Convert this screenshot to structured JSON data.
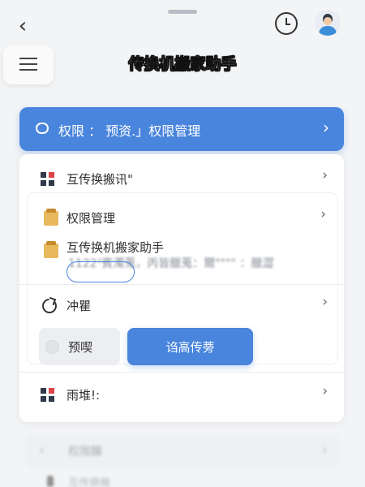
{
  "header": {
    "title": "传换机搬家助手"
  },
  "banner": {
    "label": "权限 ： 预资.」权限管理"
  },
  "rows": [
    {
      "label": "互传换搬讯\""
    },
    {
      "label": "权限管理"
    },
    {
      "label": "互传换机搬家助手"
    },
    {
      "label": "冲瞿"
    },
    {
      "label": "雨堆!:"
    }
  ],
  "blurred_detail": "1122⁷賓濁蒐，丙皆臘蒐：爾\"\"\"\" ：臘澀",
  "buttons": {
    "secondary": "预喫",
    "primary": "诌高传蒡"
  },
  "ghost": {
    "row1": "权限醸",
    "row2": "互传换機"
  },
  "colors": {
    "accent": "#4a85dd",
    "background": "#f3f4f6"
  },
  "icons": [
    "back-icon",
    "clock-icon",
    "avatar",
    "menu-icon",
    "chat-icon",
    "chevron-right-icon",
    "grid-icon",
    "box-icon",
    "refresh-icon"
  ]
}
